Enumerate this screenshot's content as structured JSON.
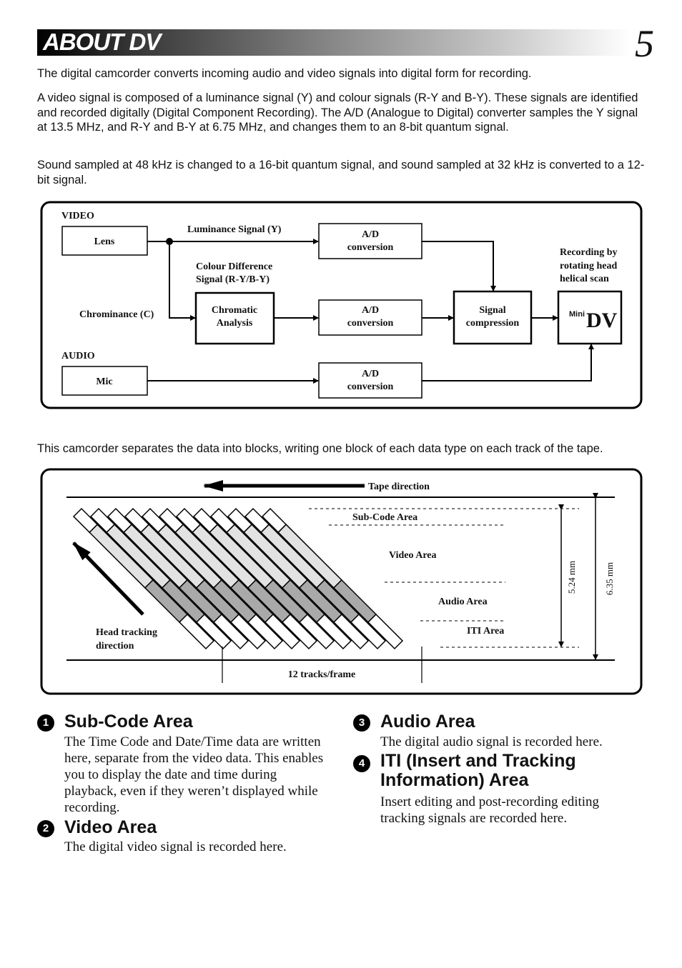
{
  "header": {
    "title": "ABOUT DV",
    "page_number": "5"
  },
  "intro": [
    "The digital camcorder converts incoming audio and video signals into digital form for recording.",
    "A video signal is composed of a luminance signal (Y) and colour signals (R-Y and B-Y). These signals are identified and recorded digitally (Digital Component Recording). The A/D (Analogue to Digital) converter samples the Y signal at 13.5 MHz, and R-Y and B-Y at 6.75 MHz, and changes them to an 8-bit quantum signal.",
    "Sound sampled at 48 kHz is changed to a 16-bit quantum signal, and sound sampled at 32 kHz is converted to a 12-bit signal."
  ],
  "block_diagram": {
    "video_label": "VIDEO",
    "audio_label": "AUDIO",
    "lens": "Lens",
    "mic": "Mic",
    "luminance": "Luminance Signal (Y)",
    "colour_diff": [
      "Colour Difference",
      "Signal (R-Y/B-Y)"
    ],
    "chrominance": "Chrominance (C)",
    "chromatic": [
      "Chromatic",
      "Analysis"
    ],
    "ad": [
      "A/D",
      "conversion"
    ],
    "signal_comp": [
      "Signal",
      "compression"
    ],
    "recording": [
      "Recording by",
      "rotating head",
      "helical scan"
    ],
    "logo": "MiniDV"
  },
  "tracks_caption": "This camcorder separates the data into blocks, writing one block of each data type on each track of the tape.",
  "track_diagram": {
    "tape_direction": "Tape direction",
    "subcode": "Sub-Code Area",
    "video": "Video Area",
    "audio": "Audio Area",
    "iti": "ITI Area",
    "head_tracking": [
      "Head tracking",
      "direction"
    ],
    "tracks_per_frame": "12 tracks/frame",
    "track_count": 12,
    "dim_inner": "5.24 mm",
    "dim_outer": "6.35 mm",
    "colors": {
      "subcode": "#ffffff",
      "video": "#e2e2e2",
      "audio": "#a9a9a9",
      "iti": "#ffffff"
    }
  },
  "sections": [
    {
      "num": "1",
      "title": "Sub-Code Area",
      "body": "The Time Code and Date/Time data are written here, separate from the video data. This enables you to display the date and time during playback, even if they weren’t displayed while recording."
    },
    {
      "num": "2",
      "title": "Video Area",
      "body": "The digital video signal is recorded here."
    },
    {
      "num": "3",
      "title": "Audio Area",
      "body": "The digital audio signal is recorded here."
    },
    {
      "num": "4",
      "title": "ITI (Insert and Tracking Information) Area",
      "body": "Insert editing and post-recording editing tracking signals are recorded here."
    }
  ]
}
